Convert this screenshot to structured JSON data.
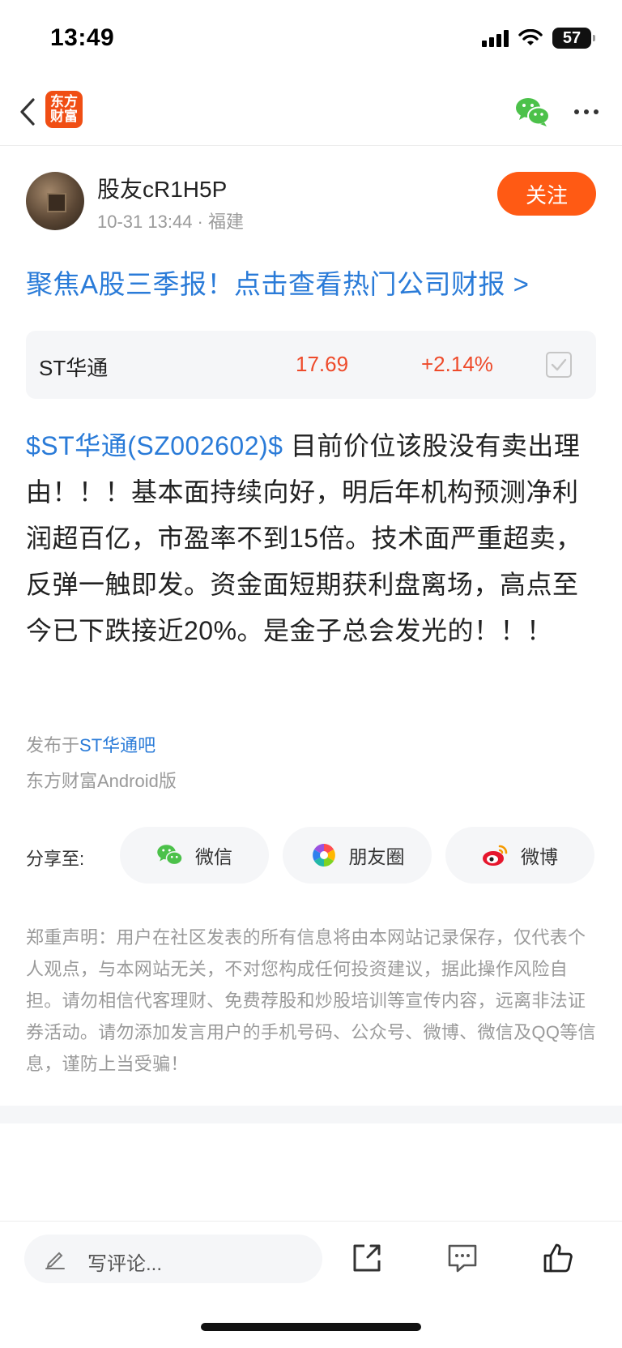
{
  "status_bar": {
    "time": "13:49",
    "battery": "57"
  },
  "nav": {
    "logo_text_line1": "东方",
    "logo_text_line2": "财富"
  },
  "author": {
    "name": "股友cR1H5P",
    "meta": "10-31 13:44 · 福建",
    "follow_label": "关注"
  },
  "promo_link": "聚焦A股三季报！点击查看热门公司财报 >",
  "stock_card": {
    "name": "ST华通",
    "price": "17.69",
    "change": "+2.14%"
  },
  "post": {
    "stock_tag": "$ST华通(SZ002602)$",
    "text": " 目前价位该股没有卖出理由！！！基本面持续向好，明后年机构预测净利润超百亿，市盈率不到15倍。技术面严重超卖，反弹一触即发。资金面短期获利盘离场，高点至今已下跌接近20%。是金子总会发光的！！！"
  },
  "source": {
    "prefix": "发布于",
    "bar": "ST华通吧",
    "client": "东方财富Android版"
  },
  "share": {
    "label": "分享至:",
    "wechat": "微信",
    "moments": "朋友圈",
    "weibo": "微博"
  },
  "disclaimer": "郑重声明：用户在社区发表的所有信息将由本网站记录保存，仅代表个人观点，与本网站无关，不对您构成任何投资建议，据此操作风险自担。请勿相信代客理财、免费荐股和炒股培训等宣传内容，远离非法证券活动。请勿添加发言用户的手机号码、公众号、微博、微信及QQ等信息，谨防上当受骗！",
  "bottom_bar": {
    "comment_placeholder": "写评论..."
  },
  "colors": {
    "accent": "#ff5a14",
    "link": "#2a7bd8",
    "up": "#ee4b2b"
  }
}
